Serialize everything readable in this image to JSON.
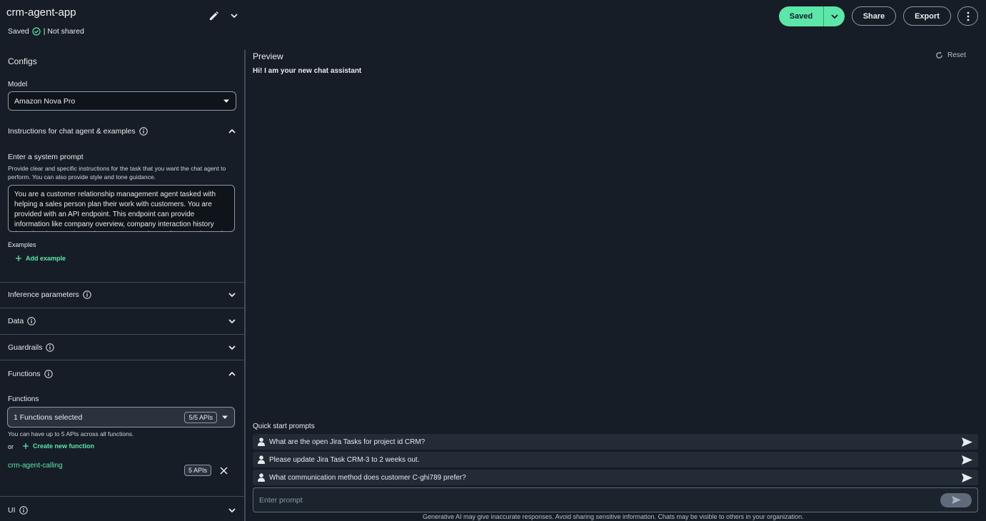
{
  "header": {
    "app_title": "crm-agent-app",
    "save_status": "Saved",
    "share_status": "| Not shared",
    "buttons": {
      "saved": "Saved",
      "share": "Share",
      "export": "Export"
    }
  },
  "configs": {
    "title": "Configs",
    "model_label": "Model",
    "model_value": "Amazon Nova Pro",
    "instructions_title": "Instructions for chat agent & examples",
    "system_prompt_label": "Enter a system prompt",
    "system_prompt_help": "Provide clear and specific instructions for the task that you want the chat agent to perform. You can also provide style and tone guidance.",
    "system_prompt_value": "You are a customer relationship management agent tasked with helping a sales person plan their work with customers. You are provided with an API endpoint. This endpoint can provide information like company overview, company interaction history (meeting times and notes), company meeting preferences (type of meeting, day of week, and time of day).",
    "examples_label": "Examples",
    "add_example": "Add example",
    "inference_title": "Inference parameters",
    "data_title": "Data",
    "guardrails_title": "Guardrails",
    "functions_title": "Functions",
    "functions_label": "Functions",
    "functions_selected": "1 Functions selected",
    "functions_badge": "5/5 APIs",
    "functions_help": "You can have up to 5 APIs across all functions.",
    "or_text": "or",
    "create_function": "Create new function",
    "function_item": {
      "name": "crm-agent-calling",
      "apis": "5 APIs"
    },
    "ui_title": "UI"
  },
  "preview": {
    "title": "Preview",
    "reset": "Reset",
    "greeting": "Hi! I am your new chat assistant",
    "quick_start_title": "Quick start prompts",
    "quick_prompts": [
      "What are the open Jira Tasks for project id CRM?",
      "Please update Jira Task CRM-3 to 2 weeks out.",
      "What communication method does customer C-ghi789 prefer?"
    ],
    "prompt_placeholder": "Enter prompt",
    "footer_note": "Generative AI may give inaccurate responses. Avoid sharing sensitive information. Chats may be visible to others in your organization."
  },
  "colors": {
    "background": "#161d26",
    "accent": "#5ce6a8",
    "border": "#414d5c"
  }
}
